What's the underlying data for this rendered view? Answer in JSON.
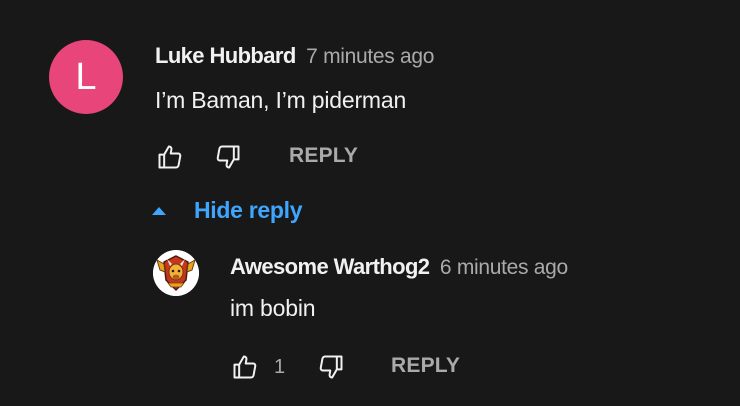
{
  "comment": {
    "avatar_letter": "L",
    "avatar_color": "#e8457a",
    "author": "Luke Hubbard",
    "time": "7 minutes ago",
    "text": "I’m Baman, I’m piderman",
    "like_icon": "thumb-up-icon",
    "dislike_icon": "thumb-down-icon",
    "reply_label": "REPLY"
  },
  "replies_toggle": {
    "label": "Hide reply",
    "icon": "caret-up-icon",
    "color": "#3ea6ff"
  },
  "reply": {
    "avatar_icon": "warthog-avatar",
    "author": "Awesome Warthog2",
    "time": "6 minutes ago",
    "text": "im bobin",
    "like_count": "1",
    "like_icon": "thumb-up-icon",
    "dislike_icon": "thumb-down-icon",
    "reply_label": "REPLY"
  },
  "colors": {
    "background": "#181818",
    "primary_text": "#f1f1f1",
    "secondary_text": "#aaaaaa"
  }
}
